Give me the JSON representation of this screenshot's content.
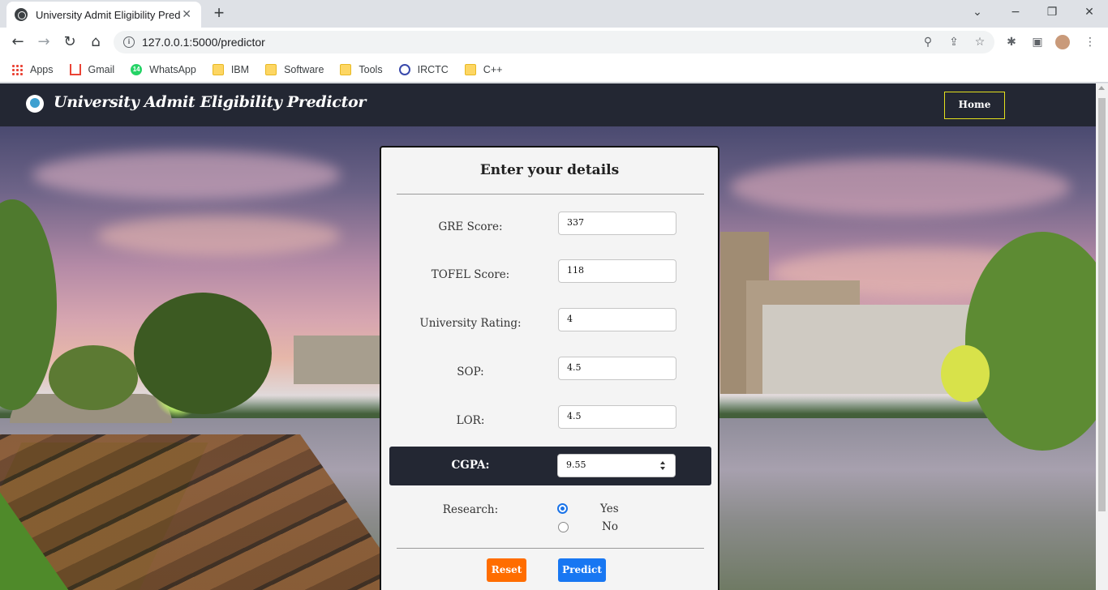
{
  "browser": {
    "tab_title": "University Admit Eligibility Predic",
    "tab_close": "✕",
    "new_tab": "+",
    "url": "127.0.0.1:5000/predictor",
    "bookmarks": [
      {
        "label": "Apps",
        "icon": "apps-grid-icon"
      },
      {
        "label": "Gmail",
        "icon": "gmail-icon"
      },
      {
        "label": "WhatsApp",
        "icon": "whatsapp-icon",
        "badge": "14"
      },
      {
        "label": "IBM",
        "icon": "folder-icon"
      },
      {
        "label": "Software",
        "icon": "folder-icon"
      },
      {
        "label": "Tools",
        "icon": "folder-icon"
      },
      {
        "label": "IRCTC",
        "icon": "irctc-icon"
      },
      {
        "label": "C++",
        "icon": "folder-icon"
      }
    ]
  },
  "navbar": {
    "brand": "University Admit Eligibility Predictor",
    "home": "Home",
    "accent": "#e4e11d",
    "bg": "#232733"
  },
  "form": {
    "title": "Enter your details",
    "fields": [
      {
        "label": "GRE Score:",
        "value": "337"
      },
      {
        "label": "TOFEL Score:",
        "value": "118"
      },
      {
        "label": "University Rating:",
        "value": "4"
      },
      {
        "label": "SOP:",
        "value": "4.5"
      },
      {
        "label": "LOR:",
        "value": "4.5"
      },
      {
        "label": "CGPA:",
        "value": "9.55"
      }
    ],
    "research": {
      "label": "Research:",
      "options": [
        "Yes",
        "No"
      ],
      "selected": "Yes"
    },
    "buttons": {
      "reset": "Reset",
      "predict": "Predict",
      "reset_color": "#ff6d00",
      "predict_color": "#1877f2"
    }
  }
}
